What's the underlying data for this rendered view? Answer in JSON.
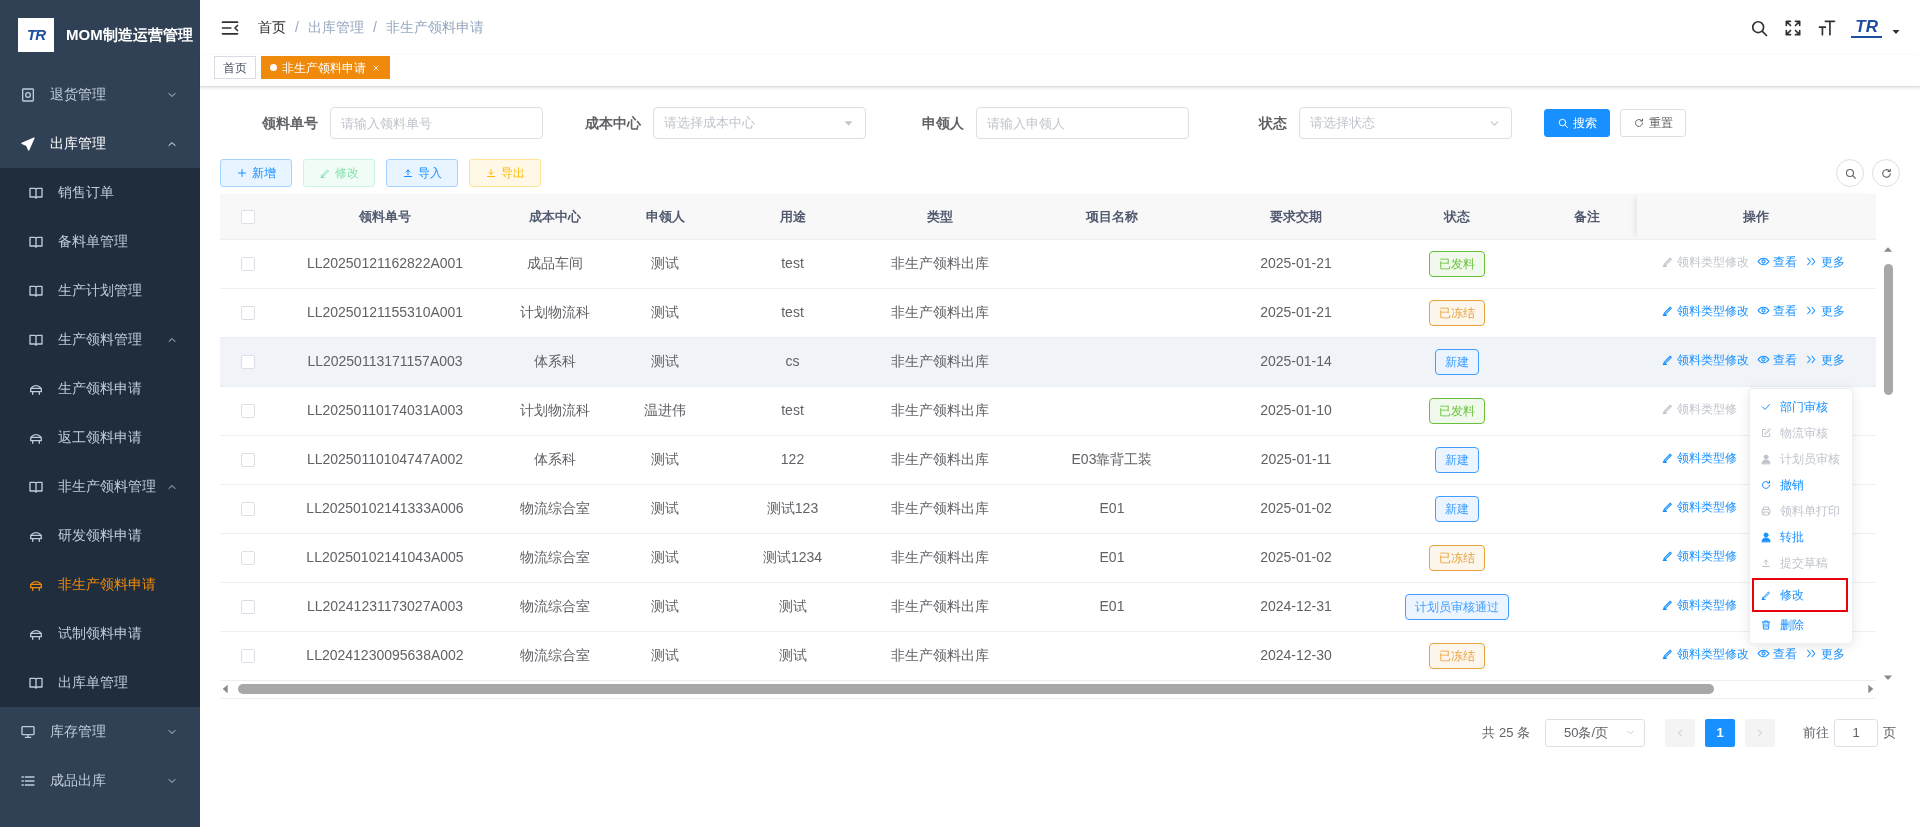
{
  "sidebar": {
    "logo_text": "TR",
    "title": "MOM制造运营管理",
    "items": [
      {
        "label": "退货管理",
        "kind": "safe",
        "expanded": false,
        "selected": false
      },
      {
        "label": "出库管理",
        "kind": "send",
        "expanded": true,
        "selected": false,
        "children": [
          {
            "label": "销售订单",
            "kind": "page",
            "selected": false
          },
          {
            "label": "备料单管理",
            "kind": "page",
            "selected": false
          },
          {
            "label": "生产计划管理",
            "kind": "page",
            "selected": false
          },
          {
            "label": "生产领料管理",
            "kind": "page",
            "expanded": true,
            "selected": false,
            "children": [
              {
                "label": "生产领料申请",
                "kind": "form",
                "selected": false
              },
              {
                "label": "返工领料申请",
                "kind": "form",
                "selected": false
              }
            ]
          },
          {
            "label": "非生产领料管理",
            "kind": "page",
            "expanded": true,
            "selected": false,
            "children": [
              {
                "label": "研发领料申请",
                "kind": "form",
                "selected": false
              },
              {
                "label": "非生产领料申请",
                "kind": "form",
                "selected": true
              },
              {
                "label": "试制领料申请",
                "kind": "form",
                "selected": false
              }
            ]
          },
          {
            "label": "出库单管理",
            "kind": "page",
            "selected": false
          }
        ]
      },
      {
        "label": "库存管理",
        "kind": "monitor",
        "expanded": false,
        "selected": false
      },
      {
        "label": "成品出库",
        "kind": "list",
        "expanded": false,
        "selected": false
      }
    ]
  },
  "header": {
    "breadcrumb": [
      {
        "label": "首页",
        "link": true
      },
      {
        "label": "出库管理",
        "link": false
      },
      {
        "label": "非生产领料申请",
        "link": false
      }
    ],
    "separator": "/",
    "avatar_text": "TR"
  },
  "tabs": [
    {
      "label": "首页",
      "selected": false,
      "closable": false
    },
    {
      "label": "非生产领料申请",
      "selected": true,
      "closable": true
    }
  ],
  "filters": [
    {
      "label": "领料单号",
      "kind": "input",
      "placeholder": "请输入领料单号"
    },
    {
      "label": "成本中心",
      "kind": "tree-select",
      "placeholder": "请选择成本中心"
    },
    {
      "label": "申领人",
      "kind": "input",
      "placeholder": "请输入申领人"
    },
    {
      "label": "状态",
      "kind": "select",
      "placeholder": "请选择状态"
    }
  ],
  "filter_buttons": [
    {
      "label": "搜索",
      "kind": "primary"
    },
    {
      "label": "重置",
      "kind": "default"
    }
  ],
  "toolbar": [
    {
      "label": "新增",
      "kind": "add",
      "disabled": false
    },
    {
      "label": "修改",
      "kind": "edit",
      "disabled": true
    },
    {
      "label": "导入",
      "kind": "import",
      "disabled": false
    },
    {
      "label": "导出",
      "kind": "export",
      "disabled": false
    }
  ],
  "table": {
    "header_checked": false,
    "columns": [
      "领料单号",
      "成本中心",
      "申领人",
      "用途",
      "类型",
      "项目名称",
      "要求交期",
      "状态",
      "备注",
      "操作"
    ],
    "rows": [
      {
        "checked": false,
        "hovered": false,
        "code": "LL20250121162822A001",
        "cost_center": "成品车间",
        "applicant": "测试",
        "purpose": "test",
        "type": "非生产领料出库",
        "due": "2025-01-21",
        "status": {
          "label": "已发料",
          "color": "#67c23a"
        },
        "actions": [
          {
            "label": "领料类型修改",
            "kind": "edit",
            "disabled": true
          },
          {
            "label": "查看",
            "kind": "view",
            "disabled": false
          },
          {
            "label": "更多",
            "kind": "more",
            "disabled": false
          }
        ]
      },
      {
        "checked": false,
        "hovered": false,
        "code": "LL20250121155310A001",
        "cost_center": "计划物流科",
        "applicant": "测试",
        "purpose": "test",
        "type": "非生产领料出库",
        "due": "2025-01-21",
        "status": {
          "label": "已冻结",
          "color": "#e6a23c"
        },
        "actions": [
          {
            "label": "领料类型修改",
            "kind": "edit",
            "disabled": false
          },
          {
            "label": "查看",
            "kind": "view",
            "disabled": false
          },
          {
            "label": "更多",
            "kind": "more",
            "disabled": false
          }
        ]
      },
      {
        "checked": false,
        "hovered": true,
        "code": "LL20250113171157A003",
        "cost_center": "体系科",
        "applicant": "测试",
        "purpose": "cs",
        "type": "非生产领料出库",
        "due": "2025-01-14",
        "status": {
          "label": "新建",
          "color": "#409eff"
        },
        "actions": [
          {
            "label": "领料类型修改",
            "kind": "edit",
            "disabled": false
          },
          {
            "label": "查看",
            "kind": "view",
            "disabled": false
          },
          {
            "label": "更多",
            "kind": "more",
            "disabled": false
          }
        ]
      },
      {
        "checked": false,
        "hovered": false,
        "code": "LL20250110174031A003",
        "cost_center": "计划物流科",
        "applicant": "温进伟",
        "purpose": "test",
        "type": "非生产领料出库",
        "due": "2025-01-10",
        "status": {
          "label": "已发料",
          "color": "#67c23a"
        },
        "actions": [
          {
            "label": "领料类型修",
            "kind": "edit",
            "disabled": true
          }
        ]
      },
      {
        "checked": false,
        "hovered": false,
        "code": "LL20250110104747A002",
        "cost_center": "体系科",
        "applicant": "测试",
        "purpose": "122",
        "type": "非生产领料出库",
        "project": "E03靠背工装",
        "due": "2025-01-11",
        "status": {
          "label": "新建",
          "color": "#409eff"
        },
        "actions": [
          {
            "label": "领料类型修",
            "kind": "edit",
            "disabled": false
          }
        ]
      },
      {
        "checked": false,
        "hovered": false,
        "code": "LL20250102141333A006",
        "cost_center": "物流综合室",
        "applicant": "测试",
        "purpose": "测试123",
        "type": "非生产领料出库",
        "project": "E01",
        "due": "2025-01-02",
        "status": {
          "label": "新建",
          "color": "#409eff"
        },
        "actions": [
          {
            "label": "领料类型修",
            "kind": "edit",
            "disabled": false
          }
        ]
      },
      {
        "checked": false,
        "hovered": false,
        "code": "LL20250102141043A005",
        "cost_center": "物流综合室",
        "applicant": "测试",
        "purpose": "测试1234",
        "type": "非生产领料出库",
        "project": "E01",
        "due": "2025-01-02",
        "status": {
          "label": "已冻结",
          "color": "#e6a23c"
        },
        "actions": [
          {
            "label": "领料类型修",
            "kind": "edit",
            "disabled": false
          }
        ]
      },
      {
        "checked": false,
        "hovered": false,
        "code": "LL20241231173027A003",
        "cost_center": "物流综合室",
        "applicant": "测试",
        "purpose": "测试",
        "type": "非生产领料出库",
        "project": "E01",
        "due": "2024-12-31",
        "status": {
          "label": "计划员审核通过",
          "color": "#409eff"
        },
        "actions": [
          {
            "label": "领料类型修",
            "kind": "edit",
            "disabled": false
          }
        ]
      },
      {
        "checked": false,
        "hovered": false,
        "code": "LL20241230095638A002",
        "cost_center": "物流综合室",
        "applicant": "测试",
        "purpose": "测试",
        "type": "非生产领料出库",
        "due": "2024-12-30",
        "status": {
          "label": "已冻结",
          "color": "#e6a23c"
        },
        "actions": [
          {
            "label": "领料类型修改",
            "kind": "edit",
            "disabled": false
          },
          {
            "label": "查看",
            "kind": "view",
            "disabled": false
          },
          {
            "label": "更多",
            "kind": "more",
            "disabled": false
          }
        ]
      }
    ]
  },
  "more_menu": {
    "items": [
      {
        "label": "部门审核",
        "kind": "check",
        "disabled": false,
        "highlighted": false
      },
      {
        "label": "物流审核",
        "kind": "edit-box",
        "disabled": true,
        "highlighted": false
      },
      {
        "label": "计划员审核",
        "kind": "user",
        "disabled": true,
        "highlighted": false
      },
      {
        "label": "撤销",
        "kind": "refresh",
        "disabled": false,
        "highlighted": false
      },
      {
        "label": "领料单打印",
        "kind": "print",
        "disabled": true,
        "highlighted": false
      },
      {
        "label": "转批",
        "kind": "user",
        "disabled": false,
        "highlighted": false
      },
      {
        "label": "提交草稿",
        "kind": "upload",
        "disabled": true,
        "highlighted": false
      },
      {
        "label": "修改",
        "kind": "edit",
        "disabled": false,
        "highlighted": true
      },
      {
        "label": "删除",
        "kind": "trash",
        "disabled": false,
        "highlighted": false
      }
    ]
  },
  "pagination": {
    "total": "共 25 条",
    "page_size": "50条/页",
    "pages": [
      {
        "label": "1",
        "selected": true
      }
    ],
    "prev_disabled": true,
    "next_disabled": true,
    "jump_label": "前往",
    "jump_value": "1",
    "jump_suffix": "页"
  }
}
